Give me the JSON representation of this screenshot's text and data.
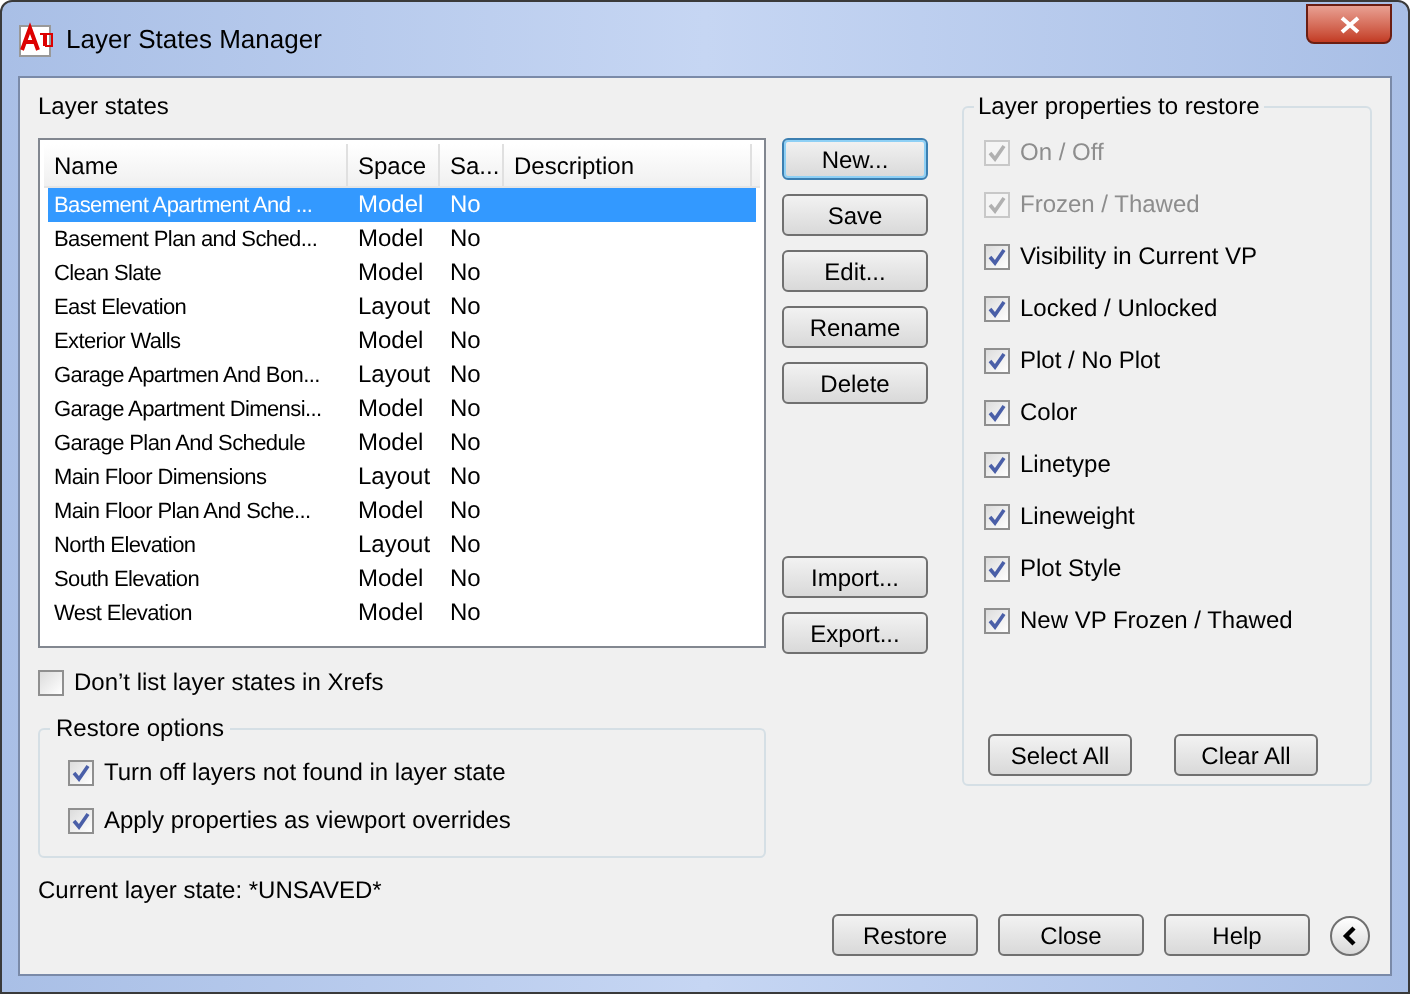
{
  "window": {
    "title": "Layer States Manager"
  },
  "layer_states": {
    "label": "Layer states",
    "columns": [
      "Name",
      "Space",
      "Sa...",
      "Description"
    ],
    "rows": [
      {
        "name": "Basement Apartment And ...",
        "space": "Model",
        "saved": "No",
        "selected": true
      },
      {
        "name": "Basement Plan and Sched...",
        "space": "Model",
        "saved": "No",
        "selected": false
      },
      {
        "name": "Clean Slate",
        "space": "Model",
        "saved": "No",
        "selected": false
      },
      {
        "name": "East Elevation",
        "space": "Layout",
        "saved": "No",
        "selected": false
      },
      {
        "name": "Exterior Walls",
        "space": "Model",
        "saved": "No",
        "selected": false
      },
      {
        "name": "Garage Apartmen And Bon...",
        "space": "Layout",
        "saved": "No",
        "selected": false
      },
      {
        "name": "Garage Apartment Dimensi...",
        "space": "Model",
        "saved": "No",
        "selected": false
      },
      {
        "name": "Garage Plan And Schedule",
        "space": "Model",
        "saved": "No",
        "selected": false
      },
      {
        "name": "Main Floor Dimensions",
        "space": "Layout",
        "saved": "No",
        "selected": false
      },
      {
        "name": "Main Floor Plan And Sche...",
        "space": "Model",
        "saved": "No",
        "selected": false
      },
      {
        "name": "North Elevation",
        "space": "Layout",
        "saved": "No",
        "selected": false
      },
      {
        "name": "South Elevation",
        "space": "Model",
        "saved": "No",
        "selected": false
      },
      {
        "name": "West Elevation",
        "space": "Model",
        "saved": "No",
        "selected": false
      }
    ]
  },
  "action_buttons": [
    {
      "label": "New...",
      "default": true
    },
    {
      "label": "Save",
      "default": false
    },
    {
      "label": "Edit...",
      "default": false
    },
    {
      "label": "Rename",
      "default": false
    },
    {
      "label": "Delete",
      "default": false
    }
  ],
  "transfer_buttons": [
    "Import...",
    "Export..."
  ],
  "xrefs_option": {
    "label": "Don’t list layer states in Xrefs",
    "checked": false
  },
  "restore_options": {
    "title": "Restore options",
    "items": [
      {
        "label": "Turn off layers not found in layer state",
        "checked": true
      },
      {
        "label": "Apply properties as viewport overrides",
        "checked": true
      }
    ]
  },
  "properties": {
    "title": "Layer properties to restore",
    "items": [
      {
        "label": "On / Off",
        "checked": true,
        "disabled": true
      },
      {
        "label": "Frozen / Thawed",
        "checked": true,
        "disabled": true
      },
      {
        "label": "Visibility in Current VP",
        "checked": true,
        "disabled": false
      },
      {
        "label": "Locked / Unlocked",
        "checked": true,
        "disabled": false
      },
      {
        "label": "Plot / No Plot",
        "checked": true,
        "disabled": false
      },
      {
        "label": "Color",
        "checked": true,
        "disabled": false
      },
      {
        "label": "Linetype",
        "checked": true,
        "disabled": false
      },
      {
        "label": "Lineweight",
        "checked": true,
        "disabled": false
      },
      {
        "label": "Plot Style",
        "checked": true,
        "disabled": false
      },
      {
        "label": "New VP Frozen / Thawed",
        "checked": true,
        "disabled": false
      }
    ],
    "buttons": [
      "Select All",
      "Clear All"
    ]
  },
  "current_state": "Current layer state: *UNSAVED*",
  "dialog_buttons": [
    "Restore",
    "Close",
    "Help"
  ]
}
